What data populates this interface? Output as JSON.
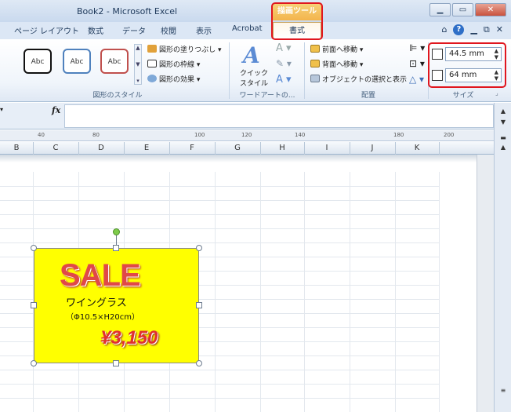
{
  "window": {
    "title": "Book2  -  Microsoft Excel",
    "context_tab_group": "描画ツール",
    "controls": {
      "minimize": "▁",
      "restore": "▭",
      "close": "✕"
    }
  },
  "tabs": [
    {
      "label": "ページ レイアウト",
      "active": false
    },
    {
      "label": "数式",
      "active": false
    },
    {
      "label": "データ",
      "active": false
    },
    {
      "label": "校閲",
      "active": false
    },
    {
      "label": "表示",
      "active": false
    },
    {
      "label": "Acrobat",
      "active": false
    },
    {
      "label": "書式",
      "active": true
    }
  ],
  "ribbon": {
    "shape_styles": {
      "label": "図形のスタイル",
      "samples": [
        {
          "text": "Abc",
          "border": "#111111"
        },
        {
          "text": "Abc",
          "border": "#4f81bd"
        },
        {
          "text": "Abc",
          "border": "#c0504d"
        }
      ],
      "fill": "図形の塗りつぶし",
      "outline": "図形の枠線",
      "effects": "図形の効果"
    },
    "wordart": {
      "label": "ワードアートの...",
      "quick_style_line1": "クイック",
      "quick_style_line2": "スタイル"
    },
    "arrange": {
      "label": "配置",
      "bring_forward": "前面へ移動",
      "send_backward": "背面へ移動",
      "selection_pane": "オブジェクトの選択と表示"
    },
    "size": {
      "label": "サイズ",
      "height": "44.5 mm",
      "width": "64 mm"
    }
  },
  "formula_bar": {
    "fx": "fx",
    "value": ""
  },
  "ruler": {
    "labels": [
      "40",
      "80",
      "100",
      "120",
      "140",
      "180",
      "200"
    ]
  },
  "columns": [
    "B",
    "C",
    "D",
    "E",
    "F",
    "G",
    "H",
    "I",
    "J",
    "K"
  ],
  "shape": {
    "fill": "#ffff00",
    "sale": "SALE",
    "product_name": "ワイングラス",
    "product_size": "（Φ10.5×H20cm）",
    "price": "¥3,150"
  },
  "colors": {
    "highlight": "#e0161e",
    "sale": "#e04848",
    "price": "#e03030"
  }
}
